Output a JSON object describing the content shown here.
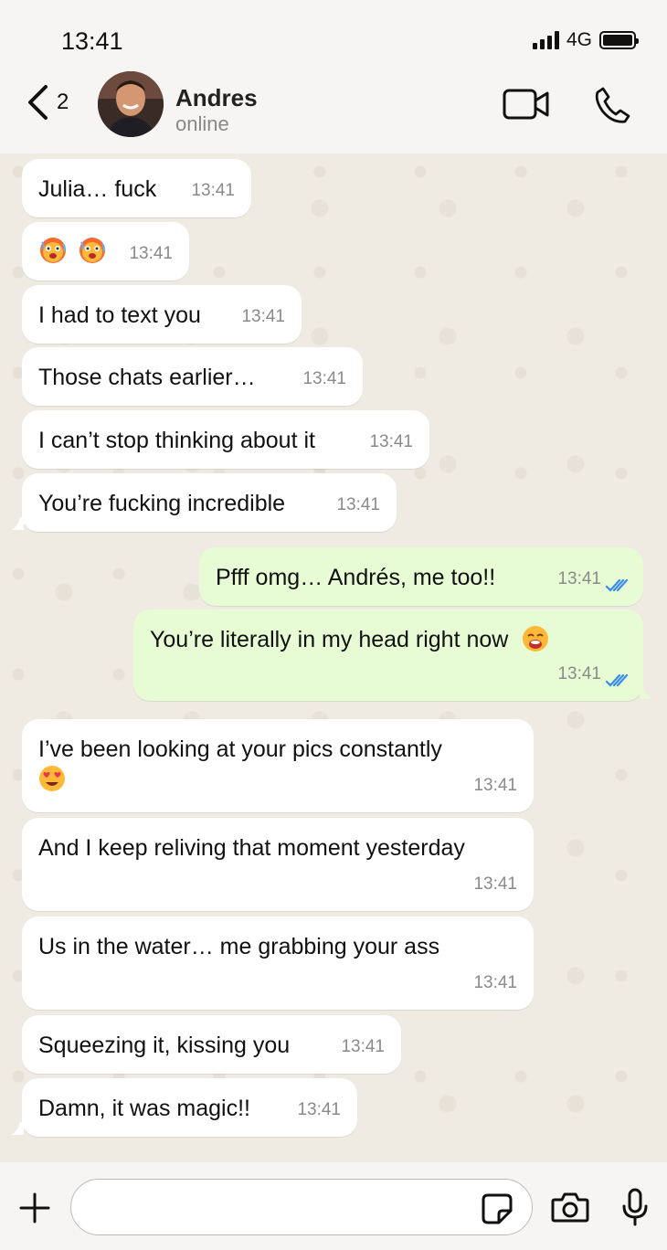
{
  "status_bar": {
    "time": "13:41",
    "network": "4G"
  },
  "header": {
    "back_count": "2",
    "contact_name": "Andres",
    "contact_status": "online"
  },
  "messages": [
    {
      "direction": "in",
      "text": "Julia… fuck",
      "time": "13:41"
    },
    {
      "direction": "in",
      "text": "",
      "emoji": [
        "hot-face-emoji",
        "hot-face-emoji"
      ],
      "time": "13:41"
    },
    {
      "direction": "in",
      "text": "I had to text you",
      "time": "13:41"
    },
    {
      "direction": "in",
      "text": "Those chats earlier…",
      "time": "13:41"
    },
    {
      "direction": "in",
      "text": "I can’t stop thinking about it",
      "time": "13:41"
    },
    {
      "direction": "in",
      "text": "You’re fucking incredible",
      "time": "13:41"
    },
    {
      "direction": "out",
      "text": "Pfff omg… Andrés, me too!!",
      "time": "13:41",
      "status": "read"
    },
    {
      "direction": "out",
      "text": "You’re literally in my head right now",
      "emoji": [
        "exhausted-face-emoji"
      ],
      "time": "13:41",
      "status": "read"
    },
    {
      "direction": "in",
      "text": "I’ve been looking at your pics constantly",
      "emoji": [
        "heart-eyes-emoji"
      ],
      "time": "13:41"
    },
    {
      "direction": "in",
      "text": "And I keep reliving that moment yesterday",
      "time": "13:41"
    },
    {
      "direction": "in",
      "text": "Us in the water… me grabbing your ass",
      "time": "13:41"
    },
    {
      "direction": "in",
      "text": "Squeezing it, kissing you",
      "time": "13:41"
    },
    {
      "direction": "in",
      "text": "Damn, it was magic!!",
      "time": "13:41"
    }
  ],
  "input": {
    "placeholder": "",
    "value": ""
  },
  "colors": {
    "incoming_bubble": "#ffffff",
    "outgoing_bubble": "#e7fcd5",
    "read_ticks": "#3a8df0",
    "chat_background": "#efeae2"
  }
}
